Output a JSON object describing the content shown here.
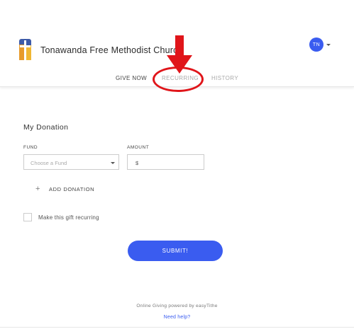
{
  "header": {
    "church_name": "Tonawanda Free Methodist Church",
    "avatar_initials": "TN",
    "logo_icon": "cross-icon"
  },
  "tabs": [
    {
      "label": "GIVE NOW",
      "active": true
    },
    {
      "label": "RECURRING",
      "active": false
    },
    {
      "label": "HISTORY",
      "active": false
    }
  ],
  "form": {
    "title": "My Donation",
    "fund_label": "FUND",
    "fund_placeholder": "Choose a Fund",
    "amount_label": "AMOUNT",
    "amount_prefix": "$",
    "add_donation_label": "ADD DONATION",
    "recurring_label": "Make this gift recurring",
    "recurring_checked": false,
    "submit_label": "SUBMIT!"
  },
  "footer": {
    "powered_by": "Online Giving powered by easyTithe",
    "help_link": "Need help?"
  },
  "colors": {
    "accent": "#3a5cf0",
    "annotation": "#e0151a"
  }
}
